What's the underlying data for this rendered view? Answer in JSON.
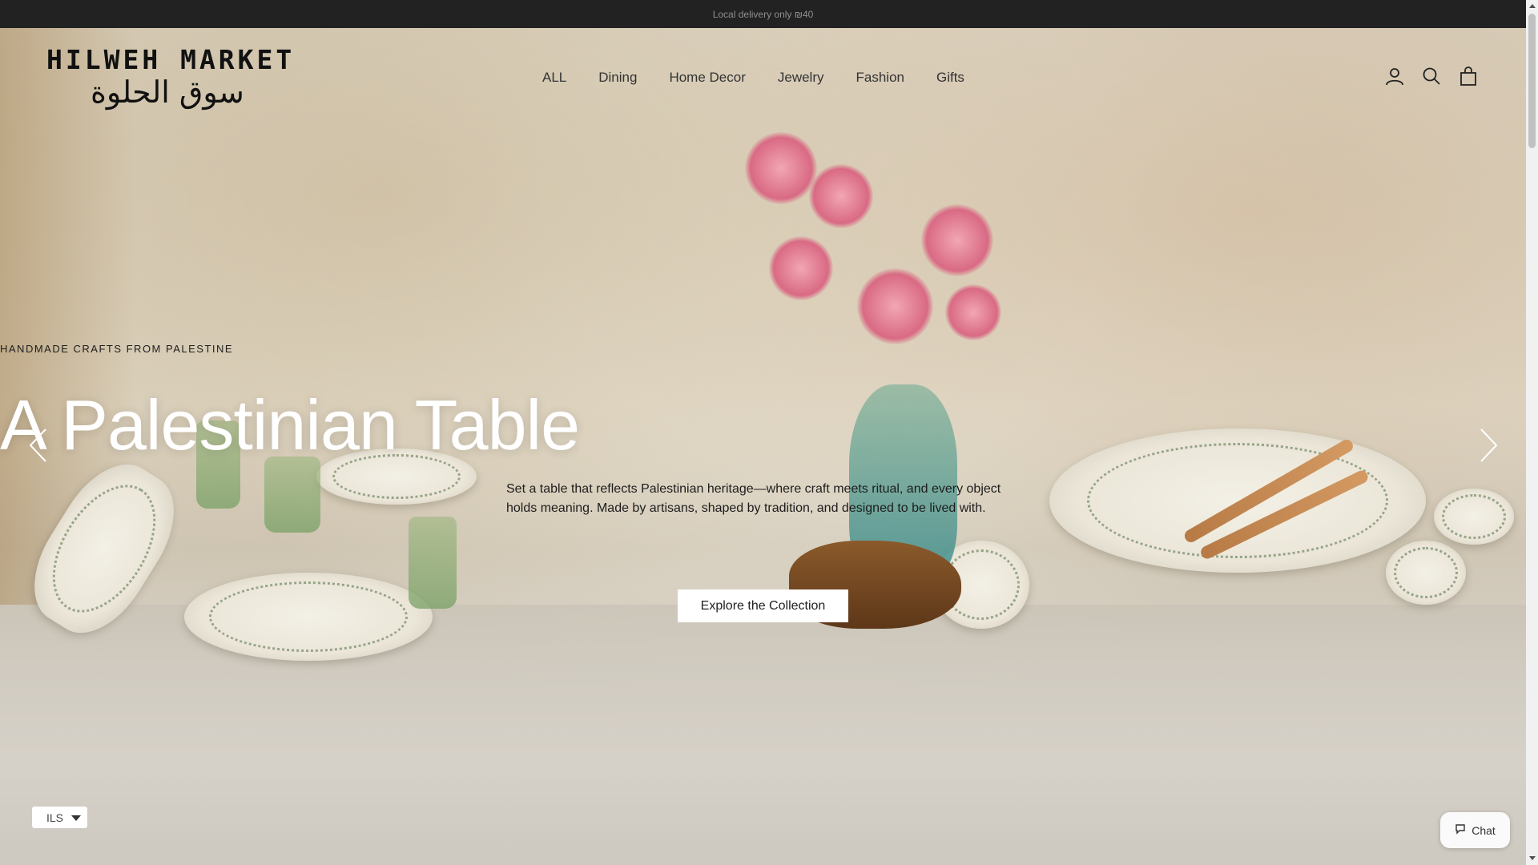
{
  "announcement": {
    "text": "Local delivery only ₪40"
  },
  "brand": {
    "name": "HILWEH MARKET",
    "name_arabic": "سوق الحلوة"
  },
  "nav": {
    "items": [
      {
        "label": "ALL"
      },
      {
        "label": "Dining"
      },
      {
        "label": "Home Decor"
      },
      {
        "label": "Jewelry"
      },
      {
        "label": "Fashion"
      },
      {
        "label": "Gifts"
      }
    ]
  },
  "header_icons": [
    "account-icon",
    "search-icon",
    "cart-icon"
  ],
  "hero": {
    "eyebrow": "HANDMADE CRAFTS FROM PALESTINE",
    "title": "A Palestinian Table",
    "description": "Set a table that reflects Palestinian heritage—where craft meets ritual, and every object holds meaning. Made by artisans, shaped by tradition, and designed to be lived with.",
    "cta_label": "Explore the Collection"
  },
  "currency": {
    "selected": "ILS"
  },
  "chat": {
    "label": "Chat"
  },
  "colors": {
    "announcement_bg": "#222222",
    "hero_title": "#ffffff",
    "cta_bg": "#ffffff"
  }
}
